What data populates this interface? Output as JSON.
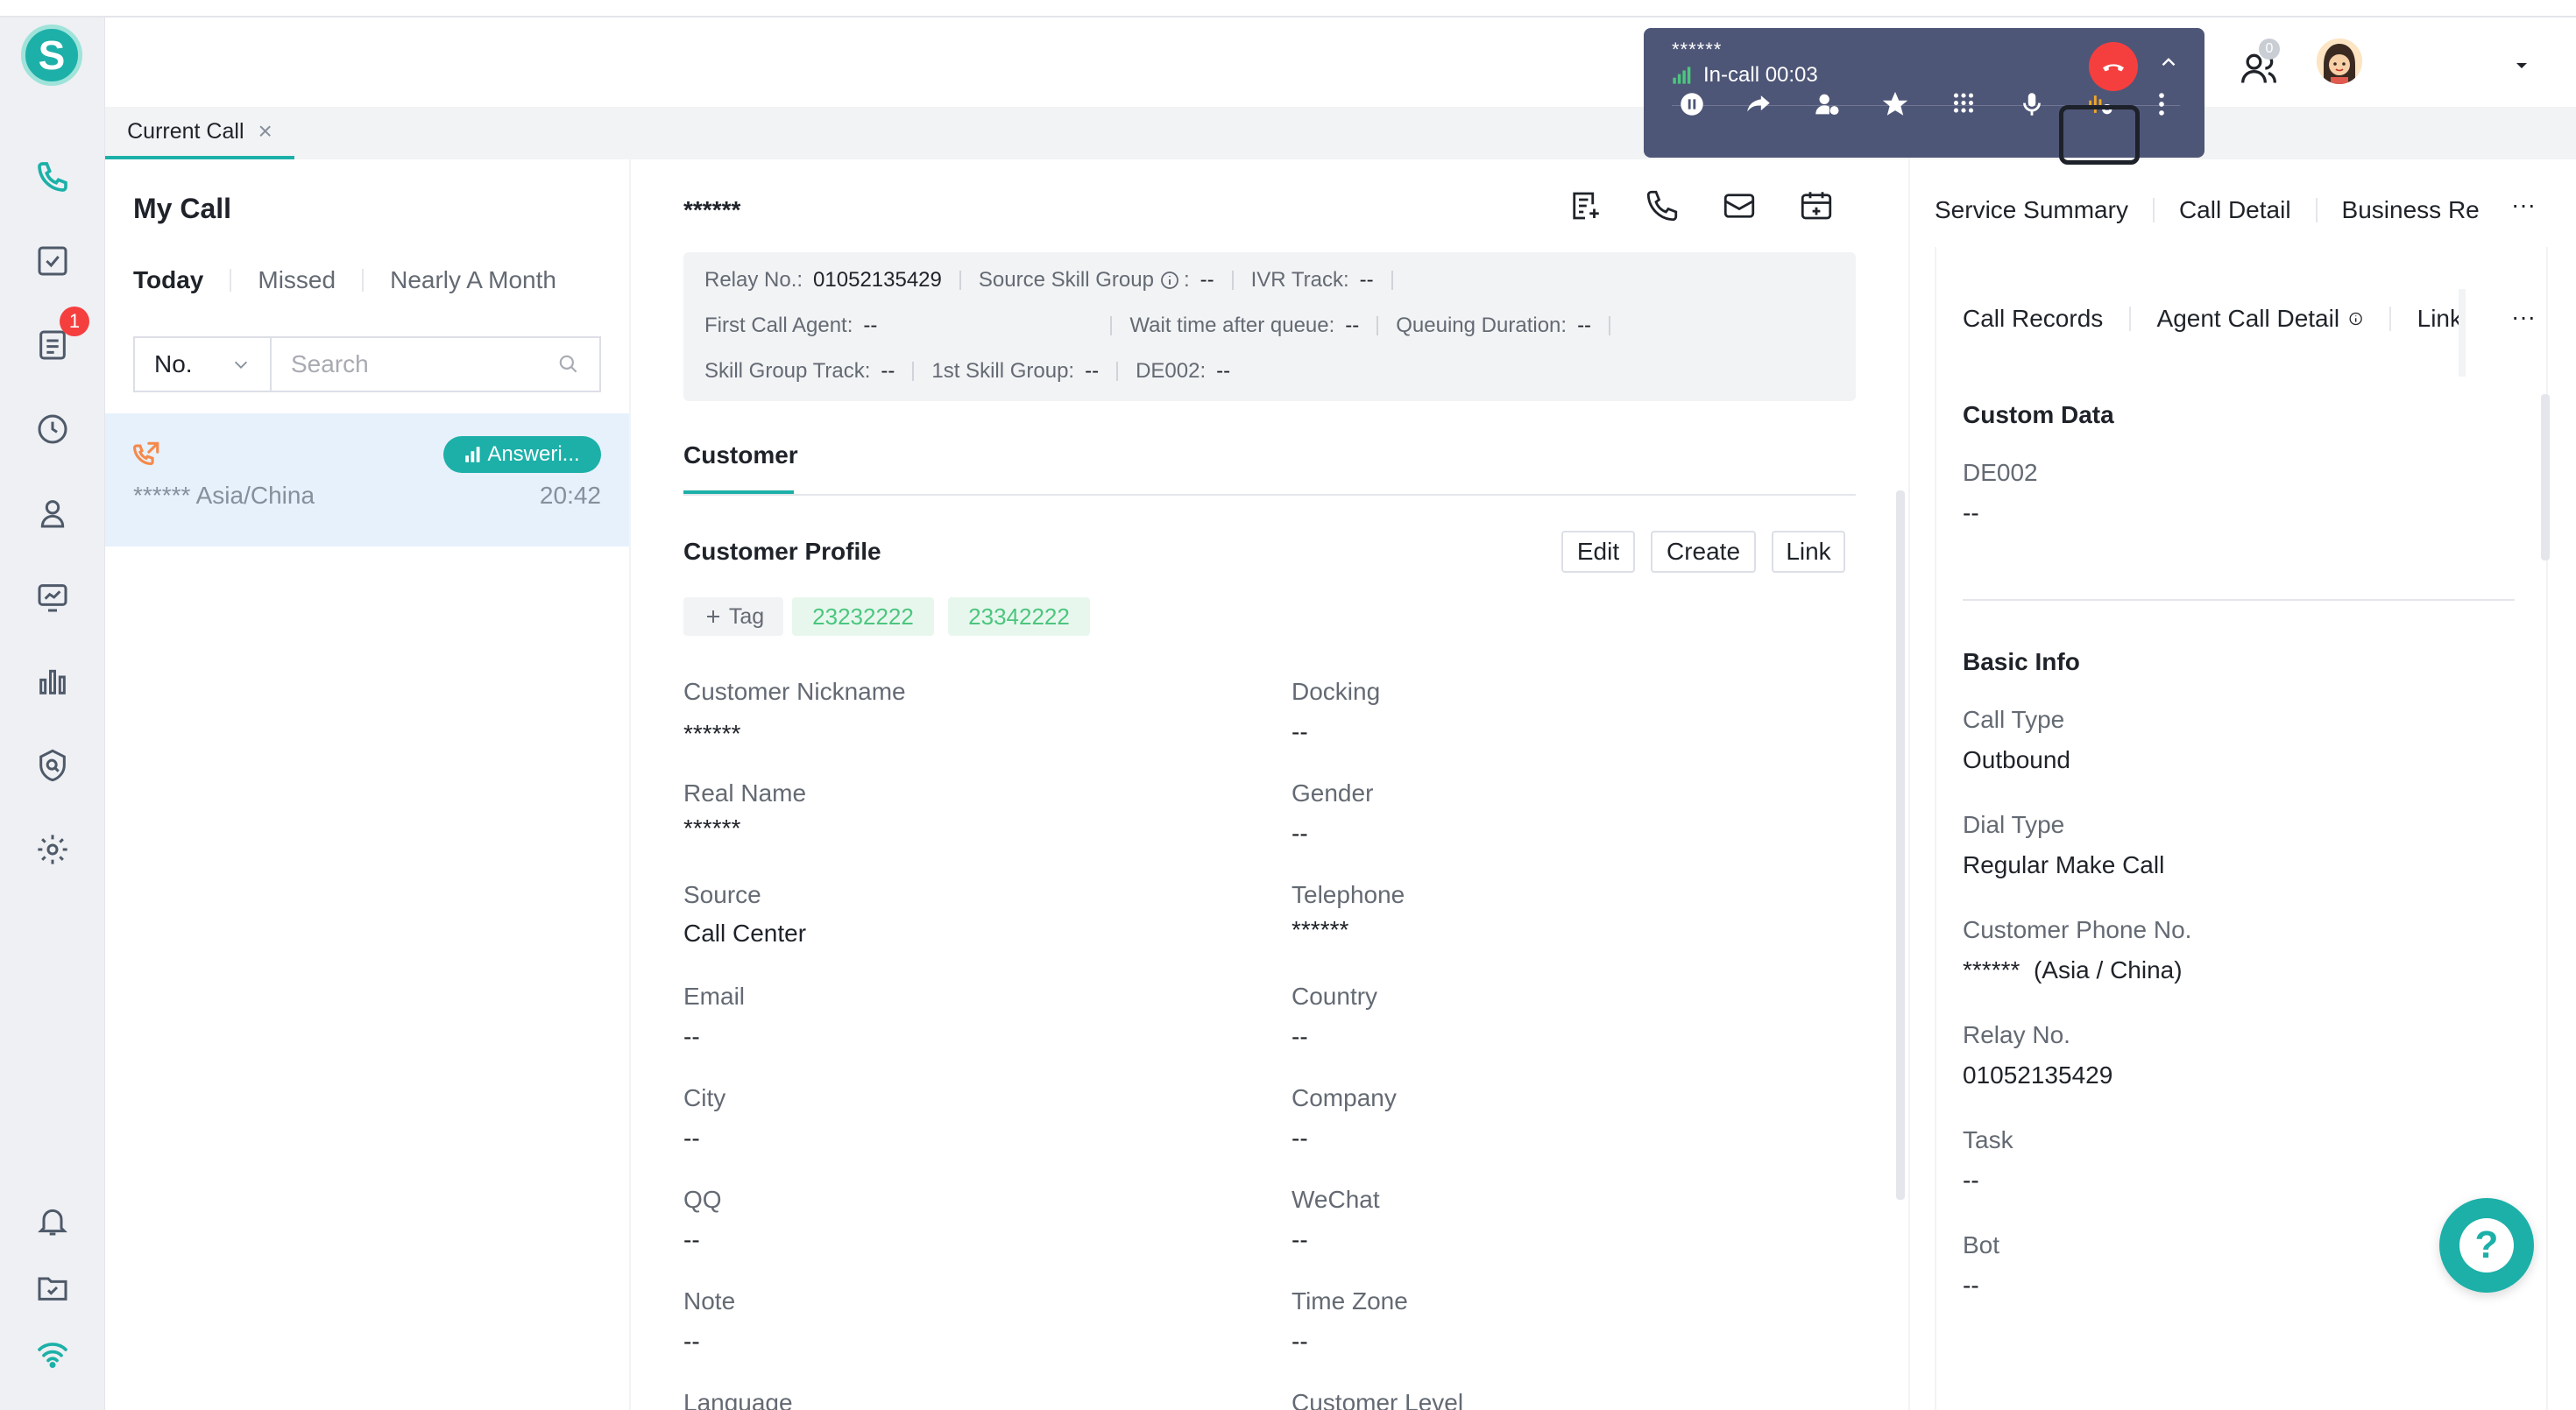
{
  "app": {
    "logo_letter": "S",
    "notification_count": "1",
    "contacts_badge": "0"
  },
  "tabs": [
    {
      "label": "Current Call",
      "close": "×"
    }
  ],
  "left": {
    "title": "My Call",
    "filters": [
      "Today",
      "Missed",
      "Nearly A Month"
    ],
    "select_value": "No.",
    "search_placeholder": "Search",
    "call": {
      "status": "Answeri...",
      "number": "****** Asia/China",
      "time": "20:42"
    }
  },
  "callbar": {
    "number": "******",
    "status": "In-call 00:03"
  },
  "middle": {
    "number": "******",
    "info": {
      "row1": [
        {
          "label": "Relay No.:",
          "value": "01052135429"
        },
        {
          "label": "Source Skill Group",
          "value": "--"
        },
        {
          "label": "IVR Track:",
          "value": "--"
        }
      ],
      "row2": [
        {
          "label": "First Call Agent:",
          "value": "--"
        },
        {
          "label": "Wait time after queue:",
          "value": "--"
        },
        {
          "label": "Queuing Duration:",
          "value": "--"
        }
      ],
      "row3": [
        {
          "label": "Skill Group Track:",
          "value": "--"
        },
        {
          "label": "1st Skill Group:",
          "value": "--"
        },
        {
          "label": "DE002:",
          "value": "--"
        }
      ]
    },
    "tab": "Customer",
    "profile_title": "Customer Profile",
    "buttons": {
      "edit": "Edit",
      "create": "Create",
      "link": "Link"
    },
    "tag_label": "Tag",
    "tags": [
      "23232222",
      "23342222"
    ],
    "fields_left": [
      {
        "label": "Customer Nickname",
        "value": "******"
      },
      {
        "label": "Real Name",
        "value": "******"
      },
      {
        "label": "Source",
        "value": "Call Center"
      },
      {
        "label": "Email",
        "value": "--"
      },
      {
        "label": "City",
        "value": "--"
      },
      {
        "label": "QQ",
        "value": "--"
      },
      {
        "label": "Note",
        "value": "--"
      },
      {
        "label": "Language",
        "value": ""
      }
    ],
    "fields_right": [
      {
        "label": "Docking",
        "value": "--"
      },
      {
        "label": "Gender",
        "value": "--"
      },
      {
        "label": "Telephone",
        "value": "******"
      },
      {
        "label": "Country",
        "value": "--"
      },
      {
        "label": "Company",
        "value": "--"
      },
      {
        "label": "WeChat",
        "value": "--"
      },
      {
        "label": "Time Zone",
        "value": "--"
      },
      {
        "label": "Customer Level",
        "value": ""
      }
    ]
  },
  "right": {
    "tabs": [
      "Service Summary",
      "Call Detail",
      "Business Re"
    ],
    "subtabs": [
      "Call Records",
      "Agent Call Detail",
      "Link"
    ],
    "custom_title": "Custom Data",
    "custom_fields": [
      {
        "label": "DE002",
        "value": "--"
      }
    ],
    "basic_title": "Basic Info",
    "basic_fields": [
      {
        "label": "Call Type",
        "value": "Outbound"
      },
      {
        "label": "Dial Type",
        "value": "Regular Make Call"
      },
      {
        "label": "Customer Phone No.",
        "value": "******  (Asia / China)"
      },
      {
        "label": "Relay No.",
        "value": "01052135429"
      },
      {
        "label": "Task",
        "value": "--"
      },
      {
        "label": "Bot",
        "value": "--"
      }
    ],
    "more": "···"
  },
  "help": "?"
}
